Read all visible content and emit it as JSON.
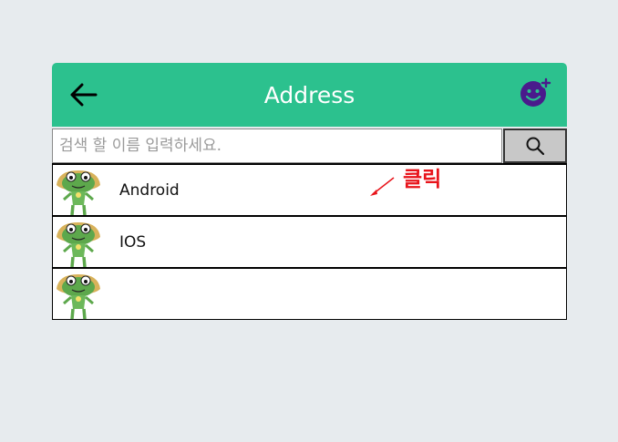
{
  "header": {
    "title": "Address",
    "back_icon": "arrow-left-icon",
    "add_icon": "add-user-icon",
    "accent_color": "#2cc18e"
  },
  "search": {
    "placeholder": "검색 할 이름 입력하세요.",
    "value": "",
    "button_icon": "search-icon"
  },
  "list": {
    "items": [
      {
        "label": "Android",
        "avatar_icon": "frog-character-icon"
      },
      {
        "label": "IOS",
        "avatar_icon": "frog-character-icon"
      },
      {
        "label": "",
        "avatar_icon": "frog-character-icon"
      }
    ]
  },
  "annotation": {
    "text": "클릭",
    "color": "#e8141b"
  }
}
